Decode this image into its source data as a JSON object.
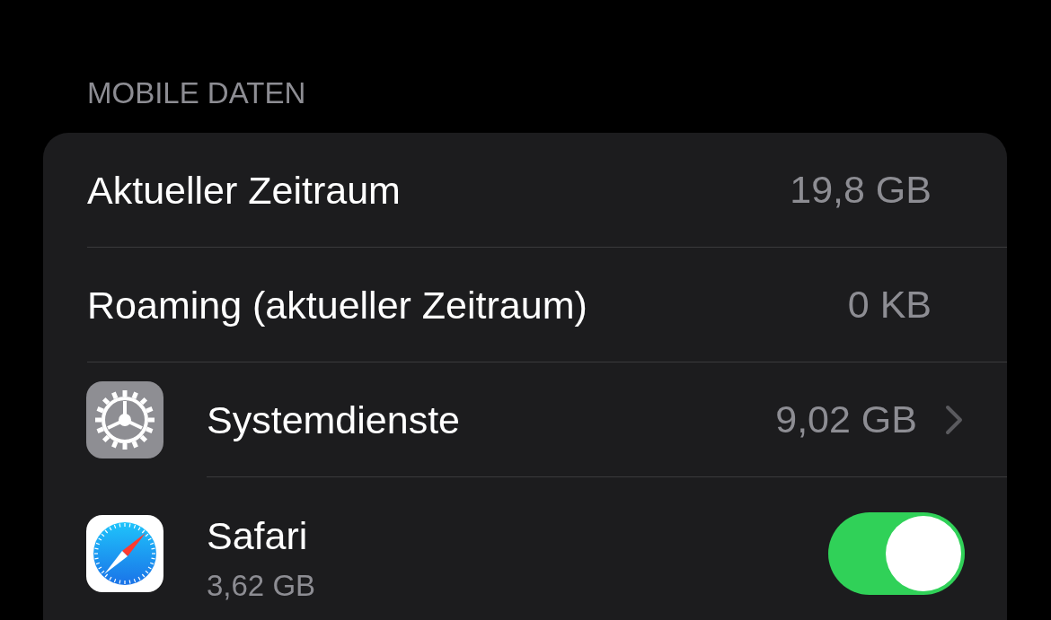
{
  "section_header": "MOBILE DATEN",
  "rows": [
    {
      "kind": "value",
      "label": "Aktueller Zeitraum",
      "value": "19,8 GB"
    },
    {
      "kind": "value",
      "label": "Roaming (aktueller Zeitraum)",
      "value": "0 KB"
    },
    {
      "kind": "link",
      "label": "Systemdienste",
      "value": "9,02 GB"
    },
    {
      "kind": "toggle",
      "label": "Safari",
      "subtitle": "3,62 GB",
      "on": true
    }
  ]
}
